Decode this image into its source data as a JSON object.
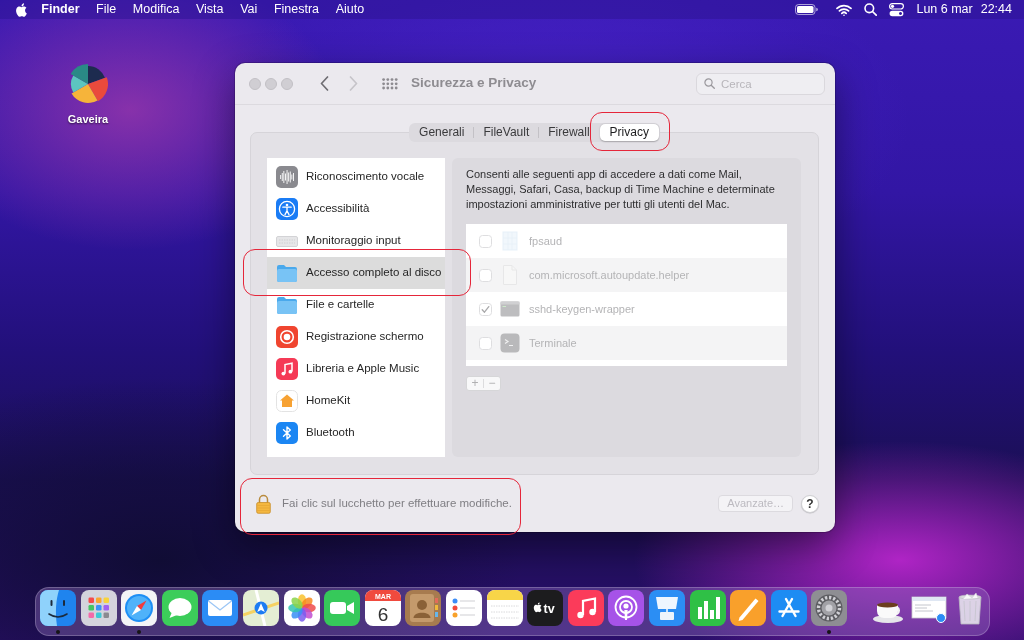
{
  "menu_bar": {
    "app_name": "Finder",
    "menus": [
      "File",
      "Modifica",
      "Vista",
      "Vai",
      "Finestra",
      "Aiuto"
    ],
    "date": "Lun 6 mar",
    "time": "22:44"
  },
  "desktop_icons": [
    {
      "label": "Gaveira"
    }
  ],
  "window": {
    "title": "Sicurezza e Privacy",
    "back": {
      "disabled": false
    },
    "forward": {
      "disabled": true
    },
    "search": {
      "placeholder": "Cerca"
    },
    "tabs": [
      {
        "label": "Generali",
        "selected": false,
        "highlighted": false
      },
      {
        "label": "FileVault",
        "selected": false,
        "highlighted": false
      },
      {
        "label": "Firewall",
        "selected": false,
        "highlighted": false
      },
      {
        "label": "Privacy",
        "selected": true,
        "highlighted": true
      }
    ],
    "sidebar": {
      "items": [
        {
          "label": "Riconoscimento vocale",
          "selected": false,
          "highlighted": false
        },
        {
          "label": "Accessibilità",
          "selected": false,
          "highlighted": false
        },
        {
          "label": "Monitoraggio input",
          "selected": false,
          "highlighted": false
        },
        {
          "label": "Accesso completo al disco",
          "selected": true,
          "highlighted": true
        },
        {
          "label": "File e cartelle",
          "selected": false,
          "highlighted": false
        },
        {
          "label": "Registrazione schermo",
          "selected": false,
          "highlighted": false
        },
        {
          "label": "Libreria e Apple Music",
          "selected": false,
          "highlighted": false
        },
        {
          "label": "HomeKit",
          "selected": false,
          "highlighted": false
        },
        {
          "label": "Bluetooth",
          "selected": false,
          "highlighted": false
        }
      ]
    },
    "description": "Consenti alle seguenti app di accedere a dati come Mail, Messaggi, Safari, Casa, backup di Time Machine e determinate impostazioni amministrative per tutti gli utenti del Mac.",
    "apps": [
      {
        "name": "fpsaud",
        "checked": false,
        "disabled": true
      },
      {
        "name": "com.microsoft.autoupdate.helper",
        "checked": false,
        "disabled": true
      },
      {
        "name": "sshd-keygen-wrapper",
        "checked": true,
        "disabled": true
      },
      {
        "name": "Terminale",
        "checked": false,
        "disabled": true
      }
    ],
    "list_buttons": {
      "add": "+",
      "remove": "−"
    },
    "footer": {
      "lock_message": "Fai clic sul lucchetto per effettuare modifiche.",
      "highlighted": true,
      "advanced_button": {
        "label": "Avanzate…",
        "disabled": true
      },
      "help_button": "?"
    }
  },
  "dock": {
    "apps": [
      {
        "running": true
      },
      {
        "running": false
      },
      {
        "running": true
      },
      {
        "running": false
      },
      {
        "running": false
      },
      {
        "running": false
      },
      {
        "running": false
      },
      {
        "running": false
      },
      {
        "running": false,
        "month": "MAR",
        "day": "6"
      },
      {
        "running": false
      },
      {
        "running": false
      },
      {
        "running": false
      },
      {
        "running": false,
        "label": "tv"
      },
      {
        "running": false
      },
      {
        "running": false
      },
      {
        "running": false
      },
      {
        "running": false
      },
      {
        "running": false
      },
      {
        "running": false
      },
      {
        "running": true
      }
    ],
    "others": [
      {
        "running": false
      },
      {
        "running": false
      },
      {
        "running": false
      }
    ]
  }
}
